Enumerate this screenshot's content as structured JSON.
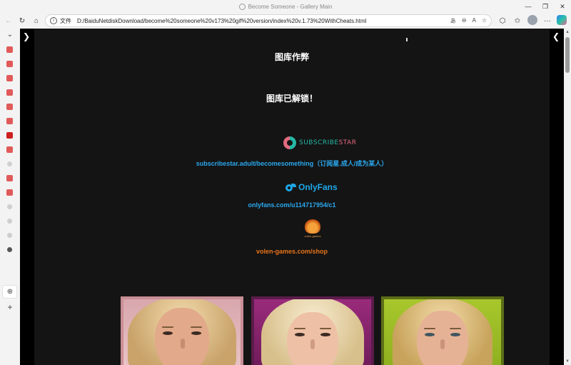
{
  "window": {
    "title": "Become Someone - Gallery Main",
    "controls": {
      "minimize": "—",
      "restore": "❐",
      "close": "✕"
    }
  },
  "toolbar": {
    "back": "←",
    "refresh": "↻",
    "home": "⌂",
    "protocol_label": "文件",
    "url": "D:/BaiduNetdiskDownload/become%20someone%20v173%20gif%20version/index%20v.1.73%20WithCheats.html",
    "icons": [
      "read-aloud-icon",
      "zoom-icon",
      "immersive-reader-icon",
      "favorite-icon",
      "extensions-icon",
      "favorites-icon",
      "profile-avatar",
      "more-icon",
      "copilot-icon"
    ]
  },
  "sidebar": {
    "collapse_glyph": "⌄",
    "add_glyph": "+"
  },
  "page": {
    "left_toggle": "❯",
    "right_toggle": "❮",
    "heading": "图库作弊",
    "subheading": "图库已解锁！",
    "subscribestar": {
      "logo_text_a": "SUBSCRIBE",
      "logo_text_b": "STAR",
      "link": "subscribestar.adult/becomesomething（订阅星.成人/成为某人）"
    },
    "onlyfans": {
      "logo_text": "OnlyFans",
      "link": "onlyfans.com/u114717954/c1"
    },
    "volen": {
      "logo_caption": "volen-games",
      "link": "volen-games.com/shop"
    }
  },
  "colors": {
    "page_bg": "#141414",
    "link_blue": "#2aa8ee",
    "link_orange": "#e8741a",
    "ss_teal": "#27b7a6",
    "ss_pink": "#e36a7e",
    "tile_border_1": "#c98f96",
    "tile_border_2": "#5c1c4a",
    "tile_border_3": "#5c6e17"
  },
  "gallery": {
    "tiles": [
      {
        "name": "portrait-1"
      },
      {
        "name": "portrait-2"
      },
      {
        "name": "portrait-3"
      }
    ]
  }
}
